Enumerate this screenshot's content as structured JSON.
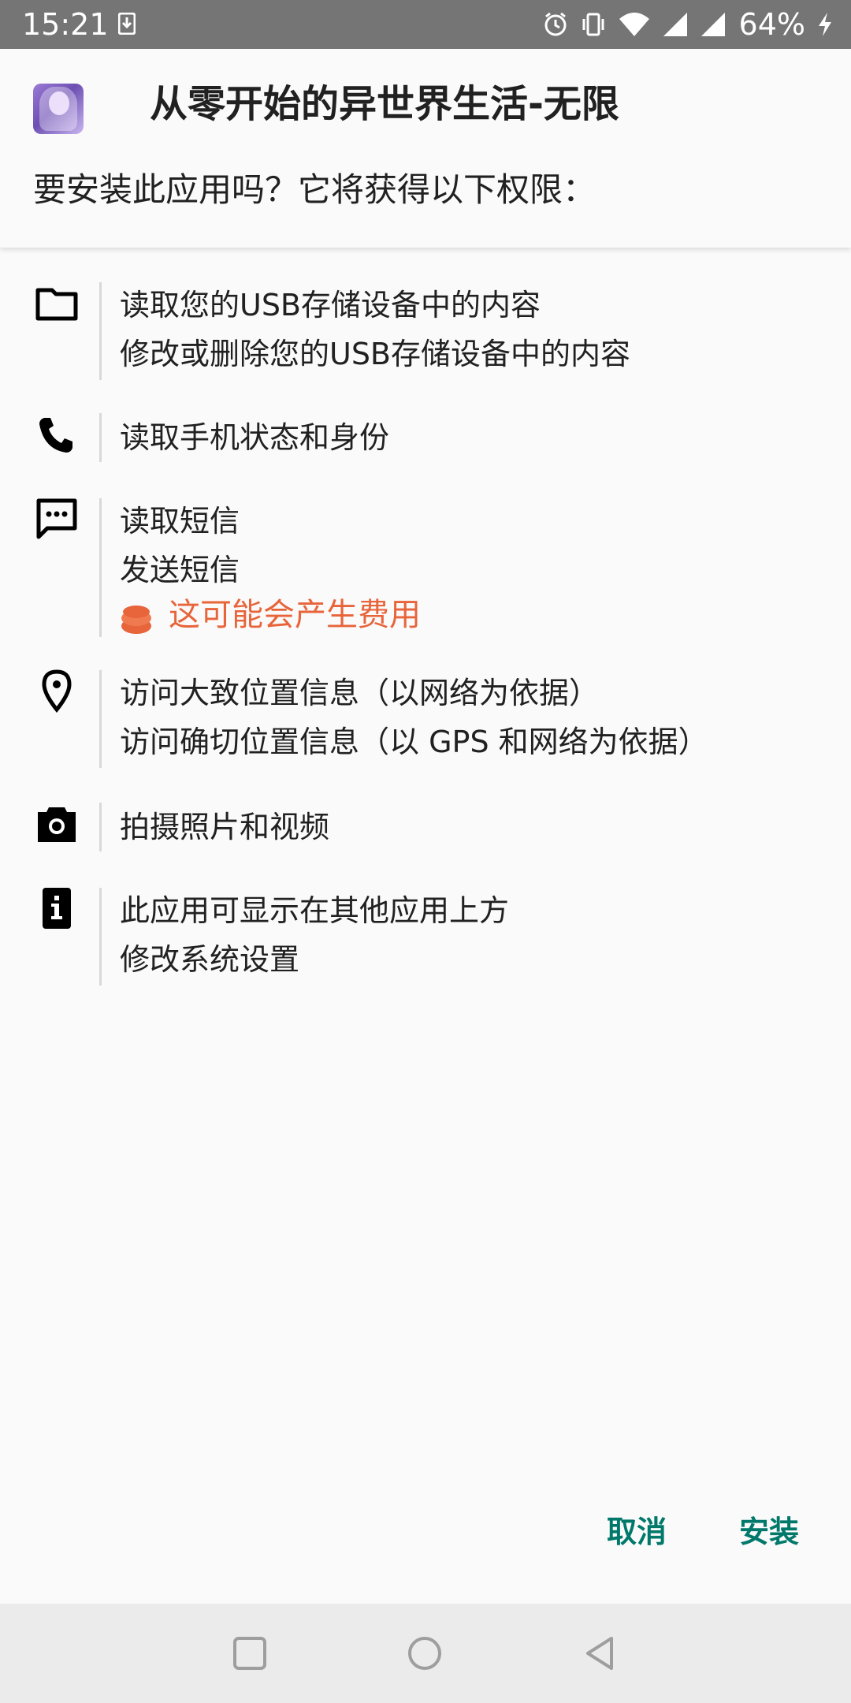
{
  "status_bar": {
    "time": "15:21",
    "battery_level": "64%",
    "icons": [
      "download-icon",
      "alarm-icon",
      "vibrate-icon",
      "wifi-icon",
      "signal-icon",
      "signal-icon",
      "charging-icon"
    ]
  },
  "header": {
    "app_name": "从零开始的异世界生活-无限",
    "question": "要安装此应用吗？它将获得以下权限："
  },
  "permissions": [
    {
      "icon": "folder-icon",
      "lines": [
        "读取您的USB存储设备中的内容",
        "修改或删除您的USB存储设备中的内容"
      ]
    },
    {
      "icon": "phone-icon",
      "lines": [
        "读取手机状态和身份"
      ]
    },
    {
      "icon": "sms-icon",
      "lines": [
        "读取短信",
        "发送短信"
      ],
      "warning": "这可能会产生费用"
    },
    {
      "icon": "location-icon",
      "lines": [
        "访问大致位置信息（以网络为依据）",
        "访问确切位置信息（以 GPS 和网络为依据）"
      ]
    },
    {
      "icon": "camera-icon",
      "lines": [
        "拍摄照片和视频"
      ]
    },
    {
      "icon": "info-icon",
      "lines": [
        "此应用可显示在其他应用上方",
        "修改系统设置"
      ]
    }
  ],
  "actions": {
    "cancel": "取消",
    "install": "安装"
  },
  "colors": {
    "accent": "#00796b",
    "warning": "#e8643a",
    "status_bar": "#757575",
    "nav_bar": "#ebebeb"
  },
  "nav_bar": {
    "buttons": [
      "recents-icon",
      "home-icon",
      "back-icon"
    ]
  }
}
